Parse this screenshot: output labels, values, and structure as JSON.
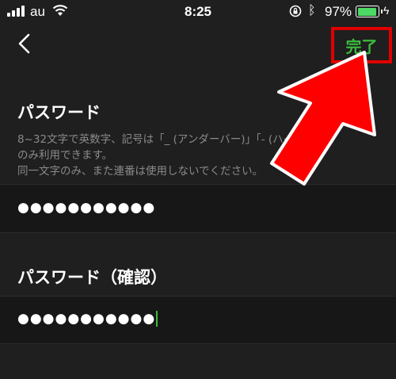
{
  "status_bar": {
    "carrier": "au",
    "time": "8:25",
    "battery_percent": "97%",
    "battery_level": 0.97,
    "icons": [
      "signal-icon",
      "wifi-icon",
      "orientation-lock-icon",
      "bluetooth-icon",
      "battery-icon",
      "charging-icon"
    ]
  },
  "nav": {
    "back_icon": "chevron-left-icon",
    "done_label": "完了",
    "done_color": "#3cbb3c",
    "highlight_color": "#e00000"
  },
  "password": {
    "label": "パスワード",
    "help_line1": "8~32文字で英数字、記号は「_ (アンダーバー)」「- (ハイフン)」",
    "help_line2": "のみ利用できます。",
    "help_line3": "同一文字のみ、また連番は使用しないでください。",
    "value_masked": "●●●●●●●●●●●"
  },
  "confirm": {
    "label": "パスワード（確認）",
    "value_masked": "●●●●●●●●●●●"
  },
  "annotation": {
    "arrow_color": "#ff0000",
    "target": "done-button"
  }
}
